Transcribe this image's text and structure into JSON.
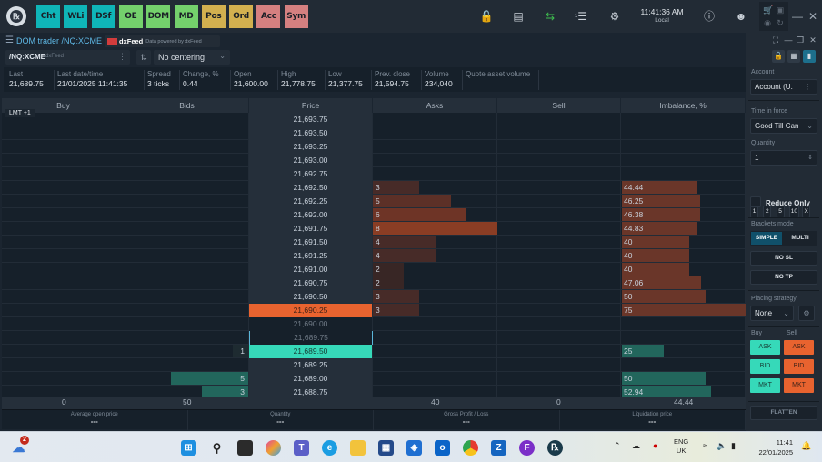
{
  "topbar": {
    "apps": [
      {
        "label": "Cht",
        "color": "#0fb5b8"
      },
      {
        "label": "WLi",
        "color": "#0fb5b8"
      },
      {
        "label": "DSf",
        "color": "#0fb5b8"
      },
      {
        "label": "OE",
        "color": "#74d16c"
      },
      {
        "label": "DOM",
        "color": "#74d16c"
      },
      {
        "label": "MD",
        "color": "#74d16c"
      },
      {
        "label": "Pos",
        "color": "#d2b04f"
      },
      {
        "label": "Ord",
        "color": "#d2b04f"
      },
      {
        "label": "Acc",
        "color": "#d58080"
      },
      {
        "label": "Sym",
        "color": "#d58080"
      }
    ],
    "icons": [
      "lock-icon",
      "window-icon",
      "swap-icon",
      "notifications-icon",
      "gear-icon",
      "help-icon",
      "user-icon",
      "minimize-icon",
      "close-icon"
    ],
    "notif_count": "1",
    "time": "11:41:36 AM",
    "time_zone": "Local"
  },
  "window": {
    "title": "DOM trader /NQ:XCME",
    "provider": "dxFeed",
    "provider_note": "Data powered by dxFeed"
  },
  "instrument": {
    "symbol": "/NQ:XCME",
    "source": "dxFeed",
    "centering": "No centering"
  },
  "stats": [
    {
      "label": "Last",
      "value": "21,689.75"
    },
    {
      "label": "Last date/time",
      "value": "21/01/2025 11:41:35"
    },
    {
      "label": "Spread",
      "value": "3 ticks"
    },
    {
      "label": "Change, %",
      "value": "0.44"
    },
    {
      "label": "Open",
      "value": "21,600.00"
    },
    {
      "label": "High",
      "value": "21,778.75"
    },
    {
      "label": "Low",
      "value": "21,377.75"
    },
    {
      "label": "Prev. close",
      "value": "21,594.75"
    },
    {
      "label": "Volume",
      "value": "234,040"
    },
    {
      "label": "Quote asset volume",
      "value": ""
    }
  ],
  "dom": {
    "columns": [
      "Buy",
      "Bids",
      "Price",
      "Asks",
      "Sell",
      "Imbalance, %"
    ],
    "lmt_label": "LMT +1",
    "max_size": 8,
    "rows": [
      {
        "price": "21,693.75",
        "type": "",
        "ask": null,
        "bid": null,
        "imb": null,
        "imb_side": ""
      },
      {
        "price": "21,693.50",
        "type": "",
        "ask": null,
        "bid": null,
        "imb": null,
        "imb_side": ""
      },
      {
        "price": "21,693.25",
        "type": "",
        "ask": null,
        "bid": null,
        "imb": null,
        "imb_side": ""
      },
      {
        "price": "21,693.00",
        "type": "",
        "ask": null,
        "bid": null,
        "imb": null,
        "imb_side": ""
      },
      {
        "price": "21,692.75",
        "type": "",
        "ask": null,
        "bid": null,
        "imb": null,
        "imb_side": ""
      },
      {
        "price": "21,692.50",
        "type": "",
        "ask": 3,
        "bid": null,
        "imb": "44.44",
        "imb_side": "ask"
      },
      {
        "price": "21,692.25",
        "type": "",
        "ask": 5,
        "bid": null,
        "imb": "46.25",
        "imb_side": "ask"
      },
      {
        "price": "21,692.00",
        "type": "",
        "ask": 6,
        "bid": null,
        "imb": "46.38",
        "imb_side": "ask"
      },
      {
        "price": "21,691.75",
        "type": "",
        "ask": 8,
        "bid": null,
        "imb": "44.83",
        "imb_side": "ask"
      },
      {
        "price": "21,691.50",
        "type": "",
        "ask": 4,
        "bid": null,
        "imb": "40",
        "imb_side": "ask"
      },
      {
        "price": "21,691.25",
        "type": "",
        "ask": 4,
        "bid": null,
        "imb": "40",
        "imb_side": "ask"
      },
      {
        "price": "21,691.00",
        "type": "",
        "ask": 2,
        "bid": null,
        "imb": "40",
        "imb_side": "ask"
      },
      {
        "price": "21,690.75",
        "type": "",
        "ask": 2,
        "bid": null,
        "imb": "47.06",
        "imb_side": "ask"
      },
      {
        "price": "21,690.50",
        "type": "",
        "ask": 3,
        "bid": null,
        "imb": "50",
        "imb_side": "ask"
      },
      {
        "price": "21,690.25",
        "type": "best-ask",
        "ask": 3,
        "bid": null,
        "imb": "75",
        "imb_side": "ask"
      },
      {
        "price": "21,690.00",
        "type": "spread",
        "ask": null,
        "bid": null,
        "imb": null,
        "imb_side": ""
      },
      {
        "price": "21,689.75",
        "type": "last",
        "ask": null,
        "bid": null,
        "imb": null,
        "imb_side": ""
      },
      {
        "price": "21,689.50",
        "type": "best-bid",
        "ask": null,
        "bid": 1,
        "imb": "25",
        "imb_side": "bid"
      },
      {
        "price": "21,689.25",
        "type": "",
        "ask": null,
        "bid": null,
        "imb": null,
        "imb_side": ""
      },
      {
        "price": "21,689.00",
        "type": "",
        "ask": null,
        "bid": 5,
        "imb": "50",
        "imb_side": "bid"
      },
      {
        "price": "21,688.75",
        "type": "",
        "ask": null,
        "bid": 3,
        "imb": "52.94",
        "imb_side": "bid"
      }
    ],
    "totals": {
      "buy": "0",
      "bids": "50",
      "asks": "40",
      "sell": "0",
      "imbalance": "44.44"
    }
  },
  "position": [
    {
      "label": "Average open price",
      "value": "---"
    },
    {
      "label": "Quantity",
      "value": "---"
    },
    {
      "label": "Gross Profit / Loss",
      "value": "---"
    },
    {
      "label": "Liquidation price",
      "value": "---"
    }
  ],
  "panel": {
    "account_label": "Account",
    "account_value": "Account (U.",
    "tif_label": "Time in force",
    "tif_value": "Good Till Can",
    "qty_label": "Quantity",
    "qty_value": "1",
    "qty_presets": [
      "1",
      "2",
      "5",
      "10",
      "X"
    ],
    "reduce_only": "Reduce Only",
    "brackets_label": "Brackets mode",
    "brackets_simple": "SIMPLE",
    "brackets_multi": "MULTI",
    "no_sl": "NO SL",
    "no_tp": "NO TP",
    "strategy_label": "Placing strategy",
    "strategy_value": "None",
    "buy_label": "Buy",
    "sell_label": "Sell",
    "buy_buttons": [
      "ASK",
      "BID",
      "MKT"
    ],
    "sell_buttons": [
      "ASK",
      "BID",
      "MKT"
    ],
    "flatten": "FLATTEN"
  },
  "taskbar": {
    "weather_badge": "2",
    "apps": [
      "start",
      "search",
      "task-view",
      "copilot",
      "teams",
      "edge",
      "file-explorer",
      "store",
      "app-azure",
      "outlook",
      "chrome",
      "zoho",
      "app-f",
      "trading-app"
    ],
    "lang_top": "ENG",
    "lang_bottom": "UK",
    "time": "11:41",
    "date": "22/01/2025"
  }
}
